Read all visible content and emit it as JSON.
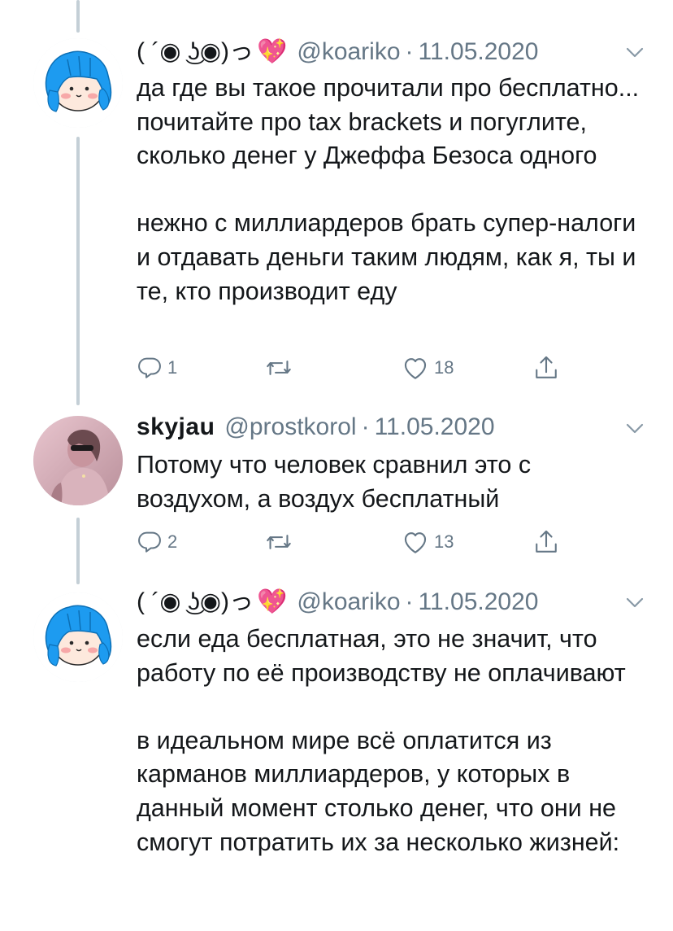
{
  "tweets": [
    {
      "display_name": "( ´◉ ͜ʖ◉)っ",
      "emoji": "💖",
      "handle": "@koariko",
      "separator": "·",
      "date": "11.05.2020",
      "avatar": "blue-hair-cartoon-avatar",
      "paragraphs": [
        "да где вы такое прочитали про бесплатно... почитайте про tax brackets и погуглите, сколько денег у Джеффа Безоса одного",
        "нежно с миллиардеров брать супер-налоги и отдавать деньги таким людям, как я, ты и те, кто производит еду"
      ],
      "replies": "1",
      "retweets": "",
      "likes": "18"
    },
    {
      "display_name": "skyjau",
      "emoji": "",
      "handle": "@prostkorol",
      "separator": "·",
      "date": "11.05.2020",
      "avatar": "photo-avatar",
      "paragraphs": [
        "Потому что человек сравнил это с воздухом, а воздух бесплатный"
      ],
      "replies": "2",
      "retweets": "",
      "likes": "13"
    },
    {
      "display_name": "( ´◉ ͜ʖ◉)っ",
      "emoji": "💖",
      "handle": "@koariko",
      "separator": "·",
      "date": "11.05.2020",
      "avatar": "blue-hair-cartoon-avatar",
      "paragraphs": [
        "если еда бесплатная, это не значит, что работу по её производству не оплачивают",
        "в идеальном мире всё оплатится из карманов миллиардеров, у которых в данный момент столько денег, что они не смогут потратить их за несколько жизней:"
      ],
      "replies": "",
      "retweets": "",
      "likes": ""
    }
  ],
  "icons": {
    "reply": "reply-icon",
    "retweet": "retweet-icon",
    "like": "heart-icon",
    "share": "share-icon",
    "caret": "chevron-down-icon"
  },
  "colors": {
    "text": "#14171a",
    "secondary": "#657786",
    "thread_line": "#c4cfd6",
    "cartoon_hair": "#1d9bf0"
  }
}
